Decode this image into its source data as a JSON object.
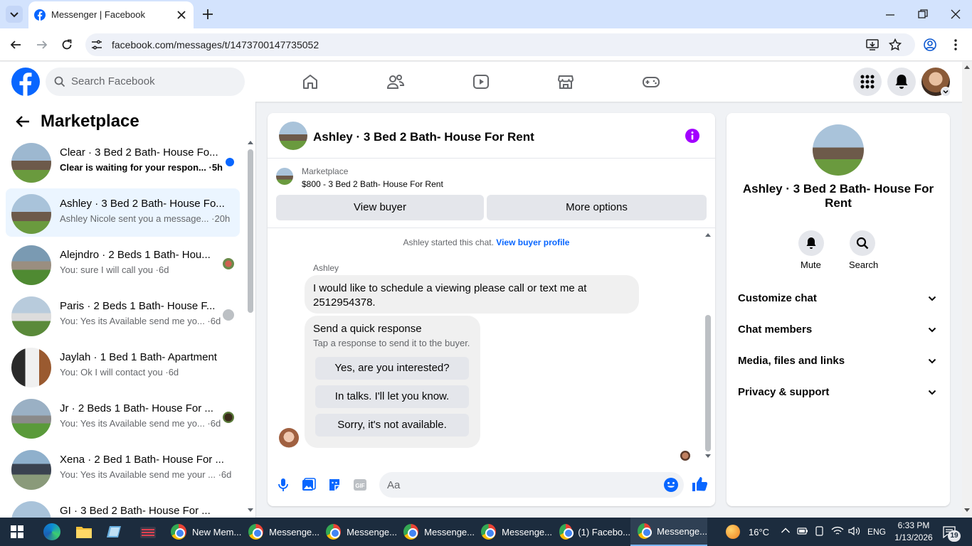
{
  "browser": {
    "tab_title": "Messenger | Facebook",
    "url": "facebook.com/messages/t/1473700147735052"
  },
  "fb_header": {
    "search_placeholder": "Search Facebook"
  },
  "sidebar": {
    "title": "Marketplace",
    "conversations": [
      {
        "name": "Clear · 3 Bed 2 Bath- House Fo...",
        "preview": "Clear is waiting for your respon... ·5h",
        "unread": true
      },
      {
        "name": "Ashley · 3 Bed 2 Bath- House Fo...",
        "preview": "Ashley Nicole sent you a message... ·20h",
        "selected": true
      },
      {
        "name": "Alejndro · 2 Beds 1 Bath- Hou...",
        "preview": "You: sure I will call you ·6d"
      },
      {
        "name": "Paris · 2 Beds 1 Bath- House F...",
        "preview": "You: Yes its Available send me yo... ·6d"
      },
      {
        "name": "Jaylah · 1 Bed 1 Bath- Apartment",
        "preview": "You: Ok I will contact you ·6d"
      },
      {
        "name": "Jr · 2 Beds 1 Bath- House For ...",
        "preview": "You: Yes its Available send me yo... ·6d"
      },
      {
        "name": "Xena · 2 Bed 1 Bath- House For ...",
        "preview": "You: Yes its Available send me your ... ·6d"
      },
      {
        "name": "GI · 3 Bed 2 Bath- House For ...",
        "preview": ""
      }
    ]
  },
  "chat": {
    "title": "Ashley · 3 Bed 2 Bath- House For Rent",
    "listing_label": "Marketplace",
    "listing_price": "$800 - 3 Bed 2 Bath- House For Rent",
    "view_buyer": "View buyer",
    "more_options": "More options",
    "started_text": "Ashley started this chat.",
    "view_profile": "View buyer profile",
    "sender": "Ashley",
    "message": "I would like to schedule a viewing please call or text me at 2512954378.",
    "quick_title": "Send a quick response",
    "quick_sub": "Tap a response to send it to the buyer.",
    "quick_options": [
      "Yes, are you interested?",
      "In talks. I'll let you know.",
      "Sorry, it's not available."
    ],
    "composer_placeholder": "Aa"
  },
  "info_panel": {
    "name": "Ashley · 3 Bed 2 Bath- House For Rent",
    "mute": "Mute",
    "search": "Search",
    "rows": [
      "Customize chat",
      "Chat members",
      "Media, files and links",
      "Privacy & support"
    ]
  },
  "taskbar": {
    "items": [
      "New Mem...",
      "Messenge...",
      "Messenge...",
      "Messenge...",
      "Messenge...",
      "(1) Facebo...",
      "Messenge..."
    ],
    "temperature": "16°C",
    "language": "ENG",
    "time": "6:33 PM",
    "date": "1/13/2026",
    "notifications": "19"
  },
  "colors": {
    "fb_blue": "#0866ff",
    "tabbar": "#d3e3fd",
    "taskbar": "#1c2c3e",
    "unread_dot": "#0866ff",
    "info_purple": "#a200ff"
  }
}
